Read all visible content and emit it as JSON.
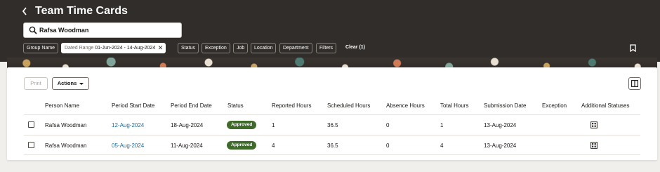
{
  "header": {
    "title": "Team Time Cards",
    "search": {
      "value": "Rafsa Woodman",
      "placeholder": ""
    },
    "filters": [
      {
        "label": "Group Name"
      },
      {
        "label": "Dated Range",
        "value": "01-Jun-2024 - 14-Aug-2024",
        "active": true
      },
      {
        "label": "Status"
      },
      {
        "label": "Exception"
      },
      {
        "label": "Job"
      },
      {
        "label": "Location"
      },
      {
        "label": "Department"
      },
      {
        "label": "Filters"
      }
    ],
    "clear_label": "Clear (1)"
  },
  "toolbar": {
    "print_label": "Print",
    "actions_label": "Actions"
  },
  "table": {
    "columns": [
      "Person Name",
      "Period Start Date",
      "Period End Date",
      "Status",
      "Reported Hours",
      "Scheduled Hours",
      "Absence Hours",
      "Total Hours",
      "Submission Date",
      "Exception",
      "Additional Statuses"
    ],
    "rows": [
      {
        "person": "Rafsa Woodman",
        "start": "12-Aug-2024",
        "end": "18-Aug-2024",
        "status": "Approved",
        "reported": "1",
        "scheduled": "36.5",
        "absence": "0",
        "total": "1",
        "submission": "13-Aug-2024",
        "exception": ""
      },
      {
        "person": "Rafsa Woodman",
        "start": "05-Aug-2024",
        "end": "11-Aug-2024",
        "status": "Approved",
        "reported": "4",
        "scheduled": "36.5",
        "absence": "0",
        "total": "4",
        "submission": "13-Aug-2024",
        "exception": ""
      }
    ]
  },
  "colors": {
    "header_bg": "#312d2a",
    "approved_badge": "#3f6b2a",
    "link": "#1f6b9e",
    "page_bg": "#f1efec"
  },
  "icons": {
    "back": "chevron-left-icon",
    "search": "search-icon",
    "bookmark": "bookmark-icon",
    "columns": "columns-icon",
    "additional_status": "status-grid-icon"
  }
}
